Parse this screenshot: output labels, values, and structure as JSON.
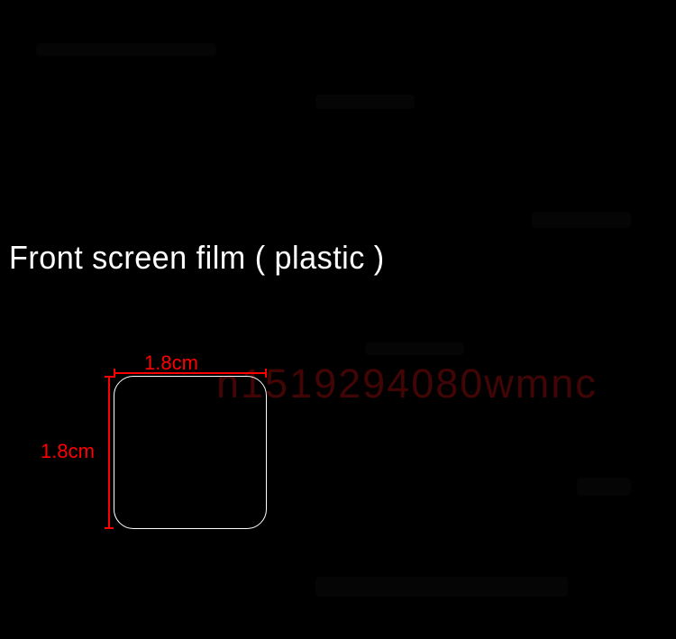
{
  "title": "Front screen film  ( plastic )",
  "dimension_top": "1.8cm",
  "dimension_left": "1.8cm",
  "watermark": "n1519294080wmnc"
}
